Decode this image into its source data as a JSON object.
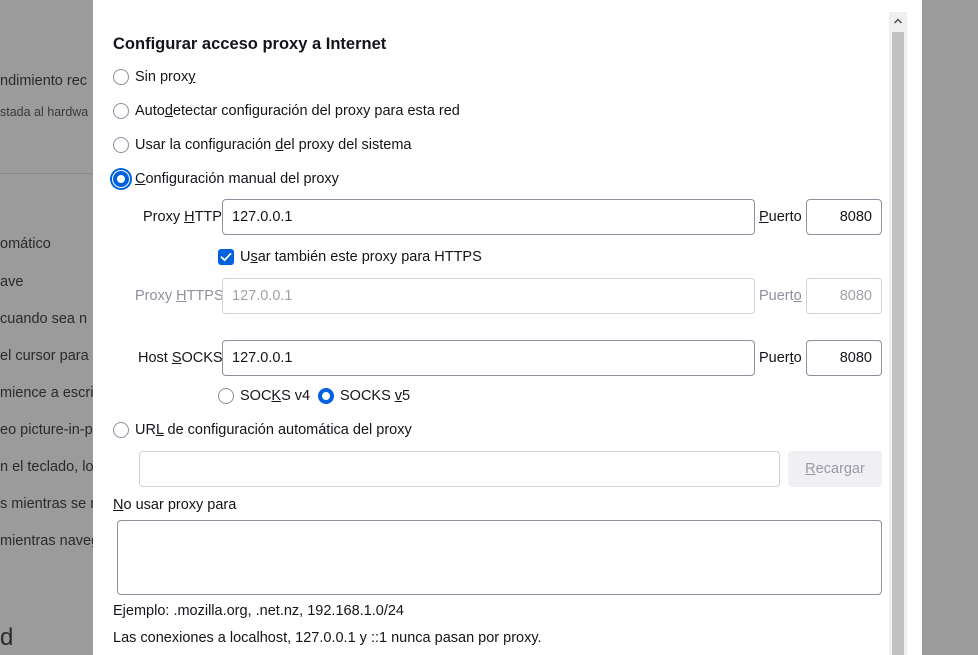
{
  "background": {
    "lines": [
      "ndimiento rec",
      "stada al hardwa",
      "omático",
      "ave",
      " cuando sea n",
      "el cursor para",
      "mience a escrib",
      "eo picture-in-p",
      "n el teclado, lo",
      "s mientras se n",
      "mientras naveg"
    ],
    "big_letter": "d"
  },
  "dialog": {
    "heading": "Configurar acceso proxy a Internet",
    "radio_no_proxy": [
      "Sin prox",
      "y",
      ""
    ],
    "radio_autodetect": [
      "Auto",
      "d",
      "etectar configuración del proxy para esta red"
    ],
    "radio_system": [
      "Usar la configuración ",
      "d",
      "el proxy del sistema"
    ],
    "radio_manual": [
      "",
      "C",
      "onfiguración manual del proxy"
    ],
    "http_label": [
      "Proxy ",
      "H",
      "TTP"
    ],
    "http_value": "127.0.0.1",
    "port_label": [
      "",
      "P",
      "uerto"
    ],
    "http_port": "8080",
    "also_https": [
      "U",
      "s",
      "ar también este proxy para HTTPS"
    ],
    "https_label": [
      "Proxy ",
      "H",
      "TTPS"
    ],
    "https_value": "127.0.0.1",
    "https_port_label": [
      "Puert",
      "o",
      ""
    ],
    "https_port": "8080",
    "socks_label": [
      "Host ",
      "S",
      "OCKS"
    ],
    "socks_value": "127.0.0.1",
    "socks_port_label": [
      "Puer",
      "t",
      "o"
    ],
    "socks_port": "8080",
    "socks_v4": [
      "SOC",
      "K",
      "S v4"
    ],
    "socks_v5": [
      "SOCKS ",
      "v",
      "5"
    ],
    "radio_auto_url": [
      "UR",
      "L",
      " de configuración automática del proxy"
    ],
    "auto_url_value": "",
    "reload_button": [
      "",
      "R",
      "ecargar"
    ],
    "no_proxy_label": [
      "",
      "N",
      "o usar proxy para"
    ],
    "no_proxy_value": "",
    "example_text": "Ejemplo: .mozilla.org, .net.nz, 192.168.1.0/24",
    "localhost_text": "Las conexiones a localhost, 127.0.0.1 y ::1 nunca pasan por proxy."
  },
  "colors": {
    "accent": "#0061e0",
    "overlay": "#9b9b9b"
  }
}
